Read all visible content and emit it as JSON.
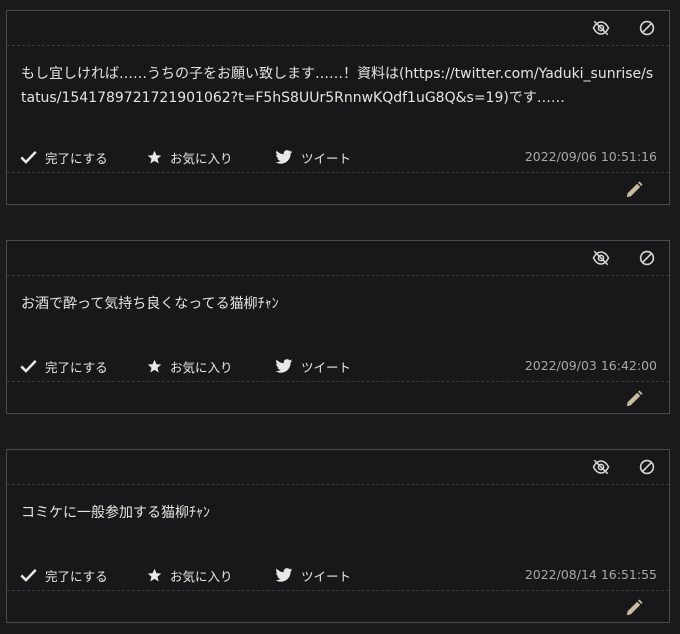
{
  "posts": [
    {
      "text": "もし宜しければ……うちの子をお願い致します……！資料は(https://twitter.com/Yaduki_sunrise/status/1541789721721901062?t=F5hS8UUr5RnnwKQdf1uG8Q&s=19)です……",
      "done_label": "完了にする",
      "fav_label": "お気に入り",
      "tweet_label": "ツイート",
      "timestamp": "2022/09/06 10:51:16"
    },
    {
      "text": "お酒で酔って気持ち良くなってる猫柳ﾁｬﾝ",
      "done_label": "完了にする",
      "fav_label": "お気に入り",
      "tweet_label": "ツイート",
      "timestamp": "2022/09/03 16:42:00"
    },
    {
      "text": "コミケに一般参加する猫柳ﾁｬﾝ",
      "done_label": "完了にする",
      "fav_label": "お気に入り",
      "tweet_label": "ツイート",
      "timestamp": "2022/08/14 16:51:55"
    }
  ],
  "icons": {
    "hide": "eye-slash-icon",
    "block": "block-icon",
    "done": "check-icon",
    "fav": "star-icon",
    "tweet": "twitter-bird-icon",
    "edit": "pencil-icon"
  },
  "colors": {
    "background": "#1b1b1d",
    "card_border": "#4a4a4e",
    "text": "#e4e4e4",
    "timestamp": "#a8a8aa",
    "icon": "#d8d8d8",
    "edit_icon": "#c8bba0"
  }
}
